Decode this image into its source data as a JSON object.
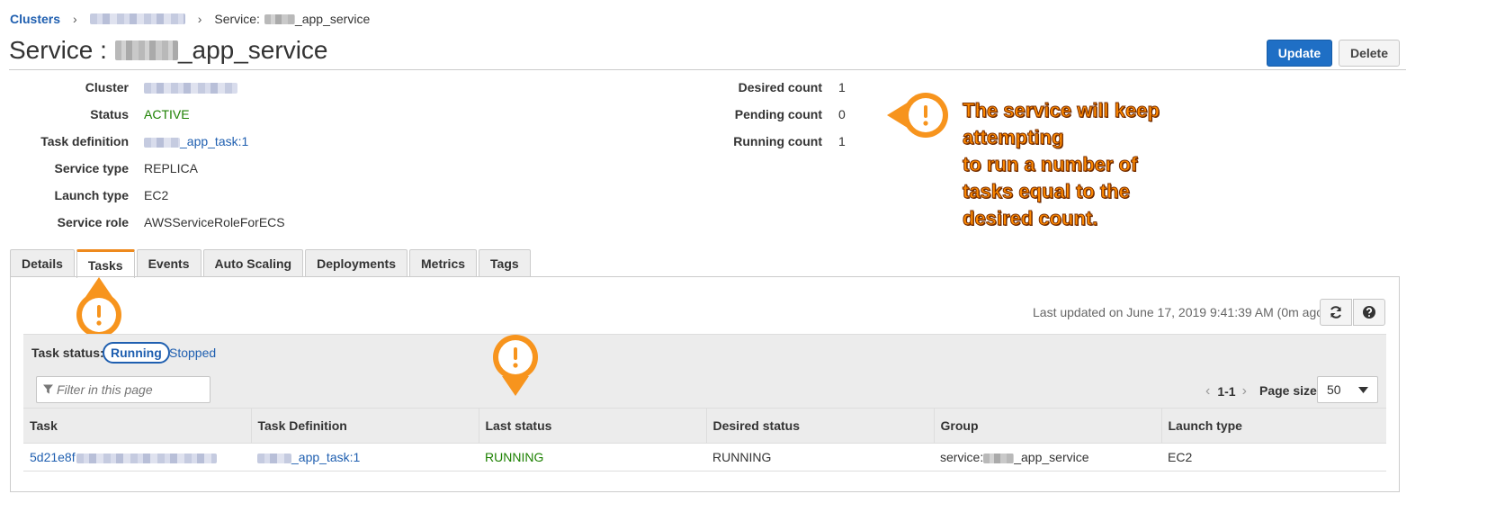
{
  "breadcrumb": {
    "root": "Clusters",
    "separator": "›",
    "current_prefix": "Service:",
    "current_suffix": "_app_service"
  },
  "header": {
    "title_prefix": "Service :",
    "title_suffix": "_app_service",
    "update_label": "Update",
    "delete_label": "Delete"
  },
  "details": {
    "left": [
      {
        "label": "Cluster",
        "value": ""
      },
      {
        "label": "Status",
        "value": "ACTIVE"
      },
      {
        "label": "Task definition",
        "value": "_app_task:1"
      },
      {
        "label": "Service type",
        "value": "REPLICA"
      },
      {
        "label": "Launch type",
        "value": "EC2"
      },
      {
        "label": "Service role",
        "value": "AWSServiceRoleForECS"
      }
    ],
    "right": [
      {
        "label": "Desired count",
        "value": "1"
      },
      {
        "label": "Pending count",
        "value": "0"
      },
      {
        "label": "Running count",
        "value": "1"
      }
    ]
  },
  "callout": {
    "lines": [
      "The service will keep",
      "attempting",
      "to run a number of",
      "tasks equal to the",
      "desired count."
    ],
    "glyph": "!",
    "color": "#f7941d"
  },
  "tabs": [
    "Details",
    "Tasks",
    "Events",
    "Auto Scaling",
    "Deployments",
    "Metrics",
    "Tags"
  ],
  "active_tab": "Tasks",
  "tasks_panel": {
    "last_updated": "Last updated on June 17, 2019 9:41:39 AM (0m ago)",
    "task_status_label": "Task status:",
    "status_running": "Running",
    "status_stopped": "Stopped",
    "filter_placeholder": "Filter in this page",
    "pager_prev": "‹",
    "pager_range": "1-1",
    "pager_next": "›",
    "page_size_label": "Page size",
    "page_size_value": "50",
    "columns": [
      "Task",
      "Task Definition",
      "Last status",
      "Desired status",
      "Group",
      "Launch type"
    ],
    "rows": [
      {
        "task": "5d21e8f",
        "task_definition": "_app_task:1",
        "last_status": "RUNNING",
        "desired_status": "RUNNING",
        "group_prefix": "service:",
        "group_suffix": "_app_service",
        "launch_type": "EC2"
      }
    ]
  }
}
